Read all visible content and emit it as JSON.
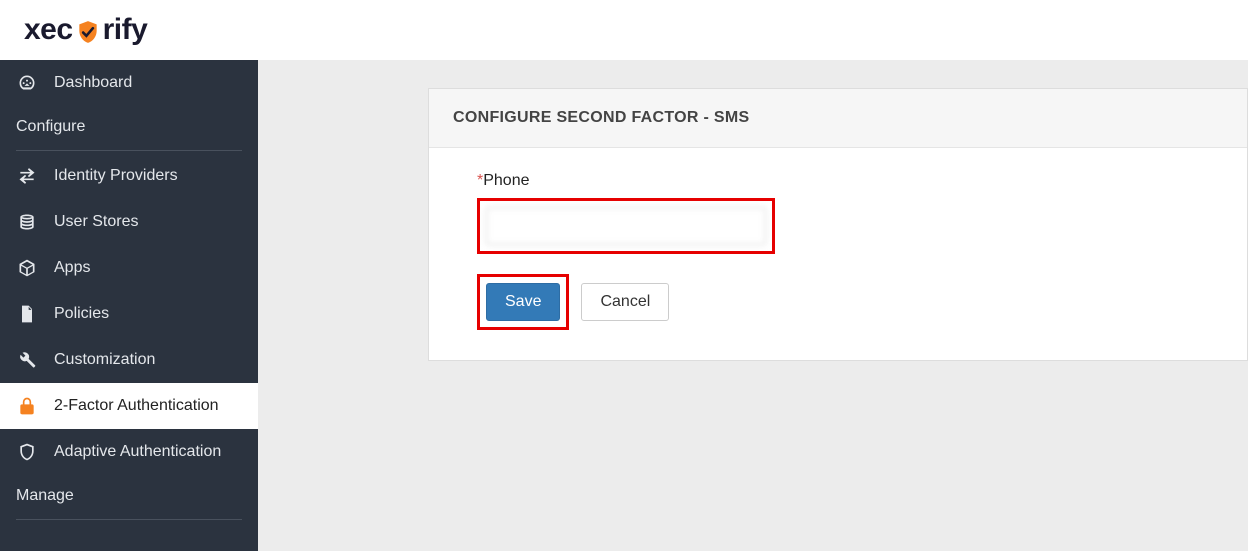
{
  "header": {
    "logo_prefix": "xec",
    "logo_suffix": "rify"
  },
  "sidebar": {
    "items": [
      {
        "label": "Dashboard",
        "icon": "dashboard-icon"
      }
    ],
    "section_configure": "Configure",
    "configure_items": [
      {
        "label": "Identity Providers",
        "icon": "exchange-icon"
      },
      {
        "label": "User Stores",
        "icon": "database-icon"
      },
      {
        "label": "Apps",
        "icon": "box-icon"
      },
      {
        "label": "Policies",
        "icon": "file-icon"
      },
      {
        "label": "Customization",
        "icon": "wrench-icon"
      },
      {
        "label": "2-Factor Authentication",
        "icon": "lock-icon",
        "active": true
      },
      {
        "label": "Adaptive Authentication",
        "icon": "shield-icon"
      }
    ],
    "section_manage": "Manage"
  },
  "panel": {
    "title": "CONFIGURE SECOND FACTOR - SMS",
    "phone_label": "Phone",
    "required_marker": "*",
    "phone_value": "",
    "save_label": "Save",
    "cancel_label": "Cancel"
  }
}
